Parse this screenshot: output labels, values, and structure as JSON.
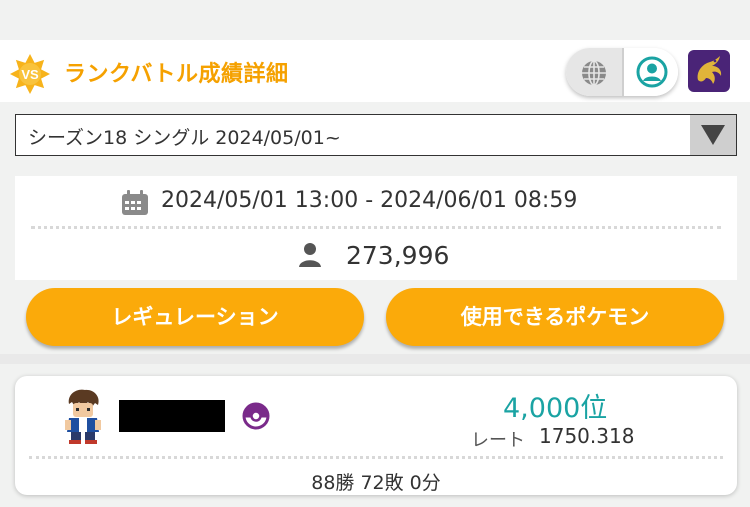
{
  "header": {
    "title": "ランクバトル成績詳細",
    "badge_text": "VS"
  },
  "season_select": {
    "value": "シーズン18 シングル 2024/05/01~"
  },
  "info": {
    "date_range": "2024/05/01 13:00 - 2024/06/01 08:59",
    "players": "273,996"
  },
  "buttons": {
    "regulation": "レギュレーション",
    "pokemon": "使用できるポケモン"
  },
  "result": {
    "rank": "4,000位",
    "rate_label": "レート",
    "rate_value": "1750.318",
    "record": "88勝 72敗 0分"
  },
  "colors": {
    "accent": "#fbaa0a",
    "title": "#f5a100",
    "rank": "#1aa3a3",
    "trainer_bg": "#4a2477"
  },
  "icons": {
    "badge": "vs-star-badge-icon",
    "globe": "globe-icon",
    "user": "user-circle-icon",
    "trainer": "trainer-dragon-icon",
    "calendar": "calendar-icon",
    "person": "person-icon",
    "ball": "pokeball-icon",
    "dropdown": "triangle-down-icon"
  }
}
